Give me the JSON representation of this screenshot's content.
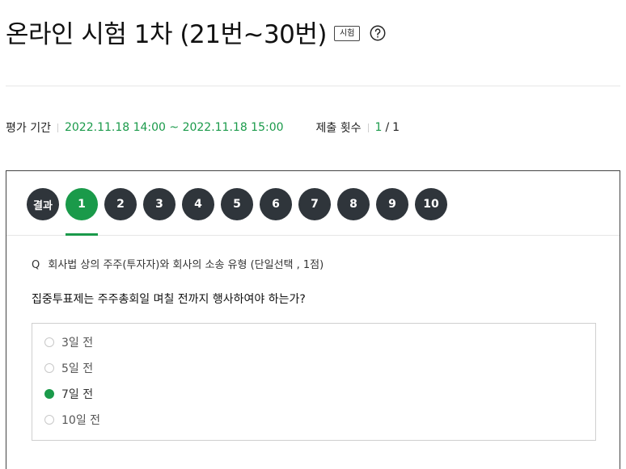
{
  "header": {
    "title": "온라인 시험 1차 (21번~30번)",
    "badge": "시험",
    "help_icon": "question-circle-icon"
  },
  "meta": {
    "period_label": "평가 기간",
    "period_value": "2022.11.18 14:00 ~ 2022.11.18 15:00",
    "submit_label": "제출 횟수",
    "submit_current": "1",
    "submit_slash": "/",
    "submit_total": "1"
  },
  "tabs": {
    "result": "결과",
    "numbers": [
      "1",
      "2",
      "3",
      "4",
      "5",
      "6",
      "7",
      "8",
      "9",
      "10"
    ],
    "active_index": 0
  },
  "question": {
    "prefix": "Q",
    "category": "회사법 상의 주주(투자자)와 회사의 소송 유형 (단일선택 , 1점)",
    "text": "집중투표제는 주주총회일 며칠 전까지 행사하여야 하는가?",
    "options": [
      "3일 전",
      "5일 전",
      "7일 전",
      "10일 전"
    ],
    "selected_index": 2
  },
  "colors": {
    "accent": "#1a9a4a",
    "tab_dark": "#2f353b",
    "border": "#cfcfcf"
  }
}
